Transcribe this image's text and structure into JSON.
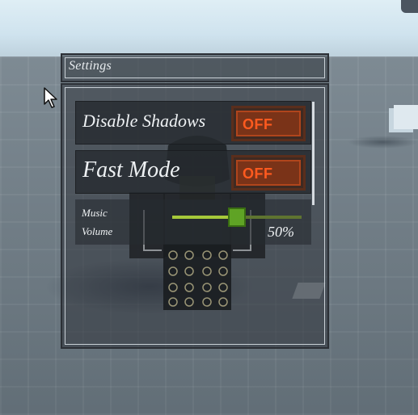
{
  "window": {
    "title": "Settings"
  },
  "settings": {
    "disable_shadows": {
      "label": "Disable Shadows",
      "value": "OFF"
    },
    "fast_mode": {
      "label": "Fast Mode",
      "value": "OFF"
    },
    "music_volume": {
      "label_line1": "Music",
      "label_line2": "Volume",
      "value": 0.5,
      "display": "50%"
    }
  },
  "colors": {
    "toggle_off_text": "#ff5a1f",
    "toggle_off_bg": "#7a3318",
    "slider_fill": "#a6c93a",
    "slider_knob": "#5fa325"
  },
  "icons": [
    "mouse-cursor-icon",
    "avatar-character"
  ]
}
